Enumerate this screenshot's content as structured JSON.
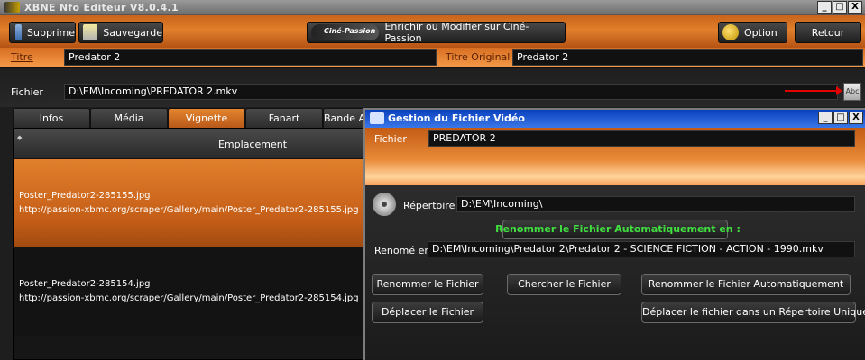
{
  "window": {
    "title": "XBNE Nfo Editeur V8.0.4.1",
    "min": "_",
    "max": "□",
    "close": "X"
  },
  "toolbar": {
    "supprime": "Supprime",
    "sauvegarde": "Sauvegarde",
    "cine_logo": "Ciné-Passion",
    "enrichir": "Enrichir ou Modifier sur Ciné-Passion",
    "option": "Option",
    "retour": "Retour"
  },
  "titre": {
    "label": "Titre",
    "value": "Predator 2",
    "orig_label": "Titre Original",
    "orig_value": "Predator 2"
  },
  "fichier": {
    "label": "Fichier",
    "value": "D:\\EM\\Incoming\\PREDATOR 2.mkv",
    "abc": "Abc"
  },
  "tabs": [
    {
      "label": "Infos"
    },
    {
      "label": "Média"
    },
    {
      "label": "Vignette"
    },
    {
      "label": "Fanart"
    },
    {
      "label": "Bande Annonce"
    }
  ],
  "grid": {
    "sort_indicator": "◆",
    "header": "Emplacement",
    "rows": [
      {
        "name": "Poster_Predator2-285155.jpg",
        "url": "http://passion-xbmc.org/scraper/Gallery/main/Poster_Predator2-285155.jpg"
      },
      {
        "name": "Poster_Predator2-285154.jpg",
        "url": "http://passion-xbmc.org/scraper/Gallery/main/Poster_Predator2-285154.jpg"
      }
    ]
  },
  "dialog": {
    "title": "Gestion du Fichier Vidéo",
    "fichier_label": "Fichier",
    "fichier_value": "PREDATOR 2",
    "repertoire_label": "Répertoire",
    "repertoire_value": "D:\\EM\\Incoming\\",
    "auto_rename_label": "Renommer le Fichier Automatiquement en :",
    "renomme_label": "Renomé en",
    "renomme_value": "D:\\EM\\Incoming\\Predator 2\\Predator 2 - SCIENCE FICTION - ACTION - 1990.mkv",
    "btn_renommer": "Renommer le Fichier",
    "btn_chercher": "Chercher le Fichier",
    "btn_renommer_auto": "Renommer le Fichier Automatiquement",
    "btn_deplacer": "Déplacer le Fichier",
    "btn_deplacer_unique": "Déplacer le fichier dans un Répertoire Unique"
  }
}
